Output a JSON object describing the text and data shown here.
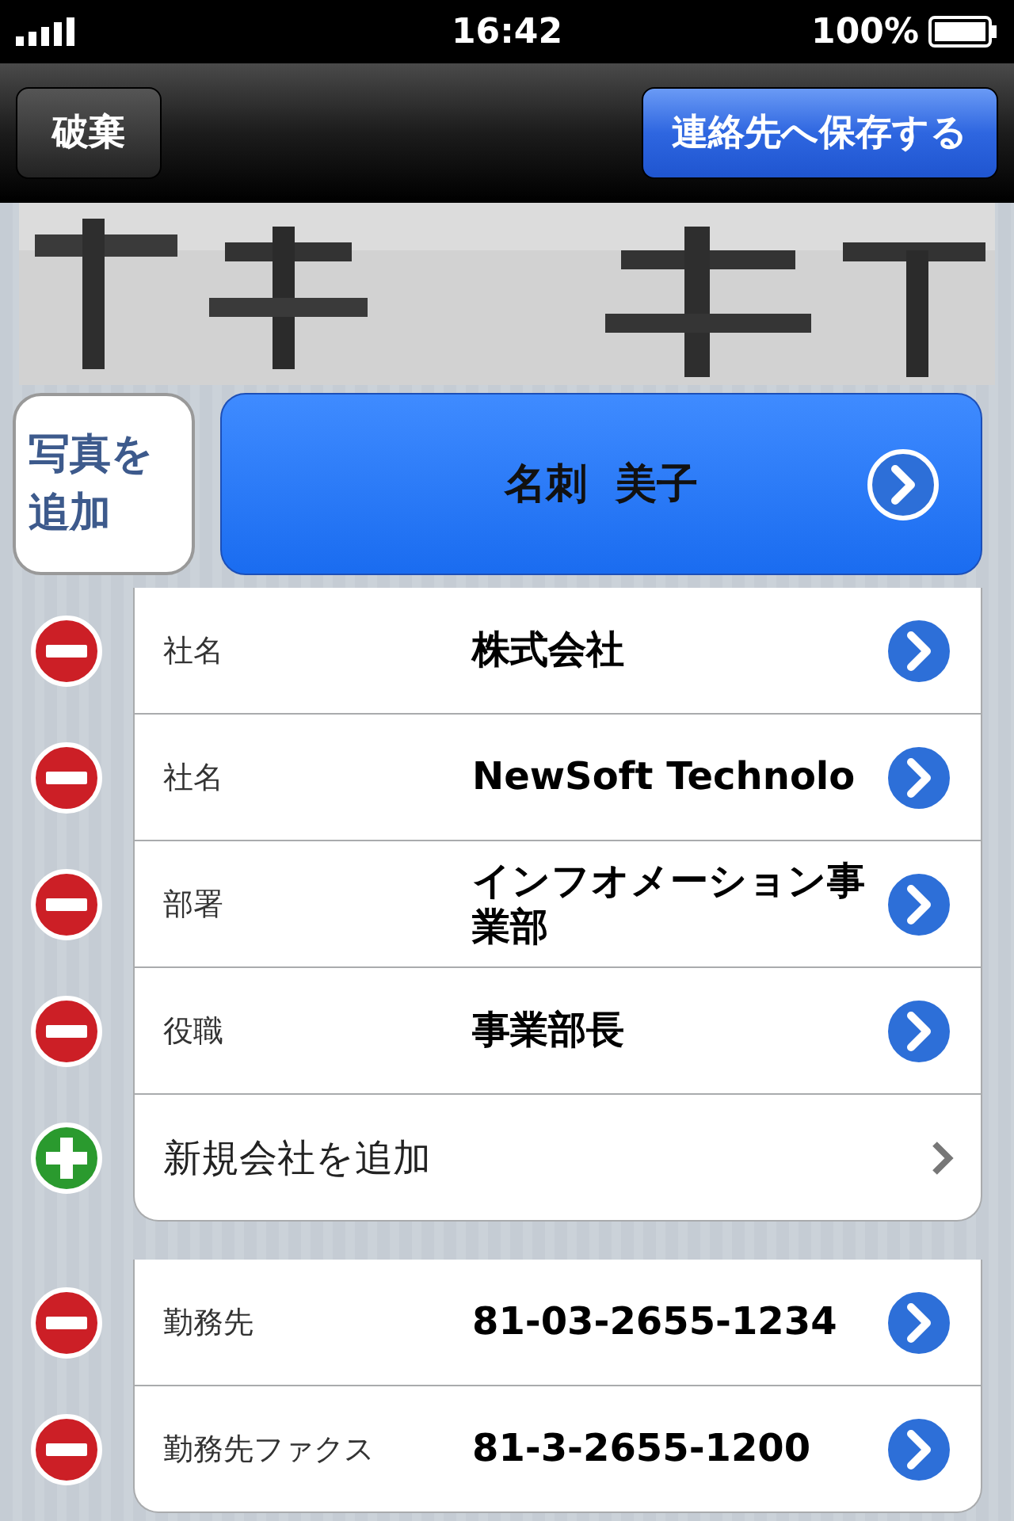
{
  "status_bar": {
    "time": "16:42",
    "battery": "100%"
  },
  "nav_bar": {
    "left_button": "破棄",
    "right_button": "連絡先へ保存する"
  },
  "add_photo_button": "写真を追加",
  "name_button": "名刺  美子",
  "groups": [
    {
      "rows": [
        {
          "kind": "field",
          "label": "社名",
          "value": "株式会社"
        },
        {
          "kind": "field",
          "label": "社名",
          "value": "NewSoft Technolo"
        },
        {
          "kind": "field",
          "label": "部署",
          "value": "インフオメーション事業部"
        },
        {
          "kind": "field",
          "label": "役職",
          "value": "事業部長"
        },
        {
          "kind": "add",
          "label": "新規会社を追加"
        }
      ]
    },
    {
      "rows": [
        {
          "kind": "field",
          "label": "勤務先",
          "value": "81-03-2655-1234"
        },
        {
          "kind": "field",
          "label": "勤務先ファクス",
          "value": "81-3-2655-1200"
        }
      ]
    }
  ]
}
